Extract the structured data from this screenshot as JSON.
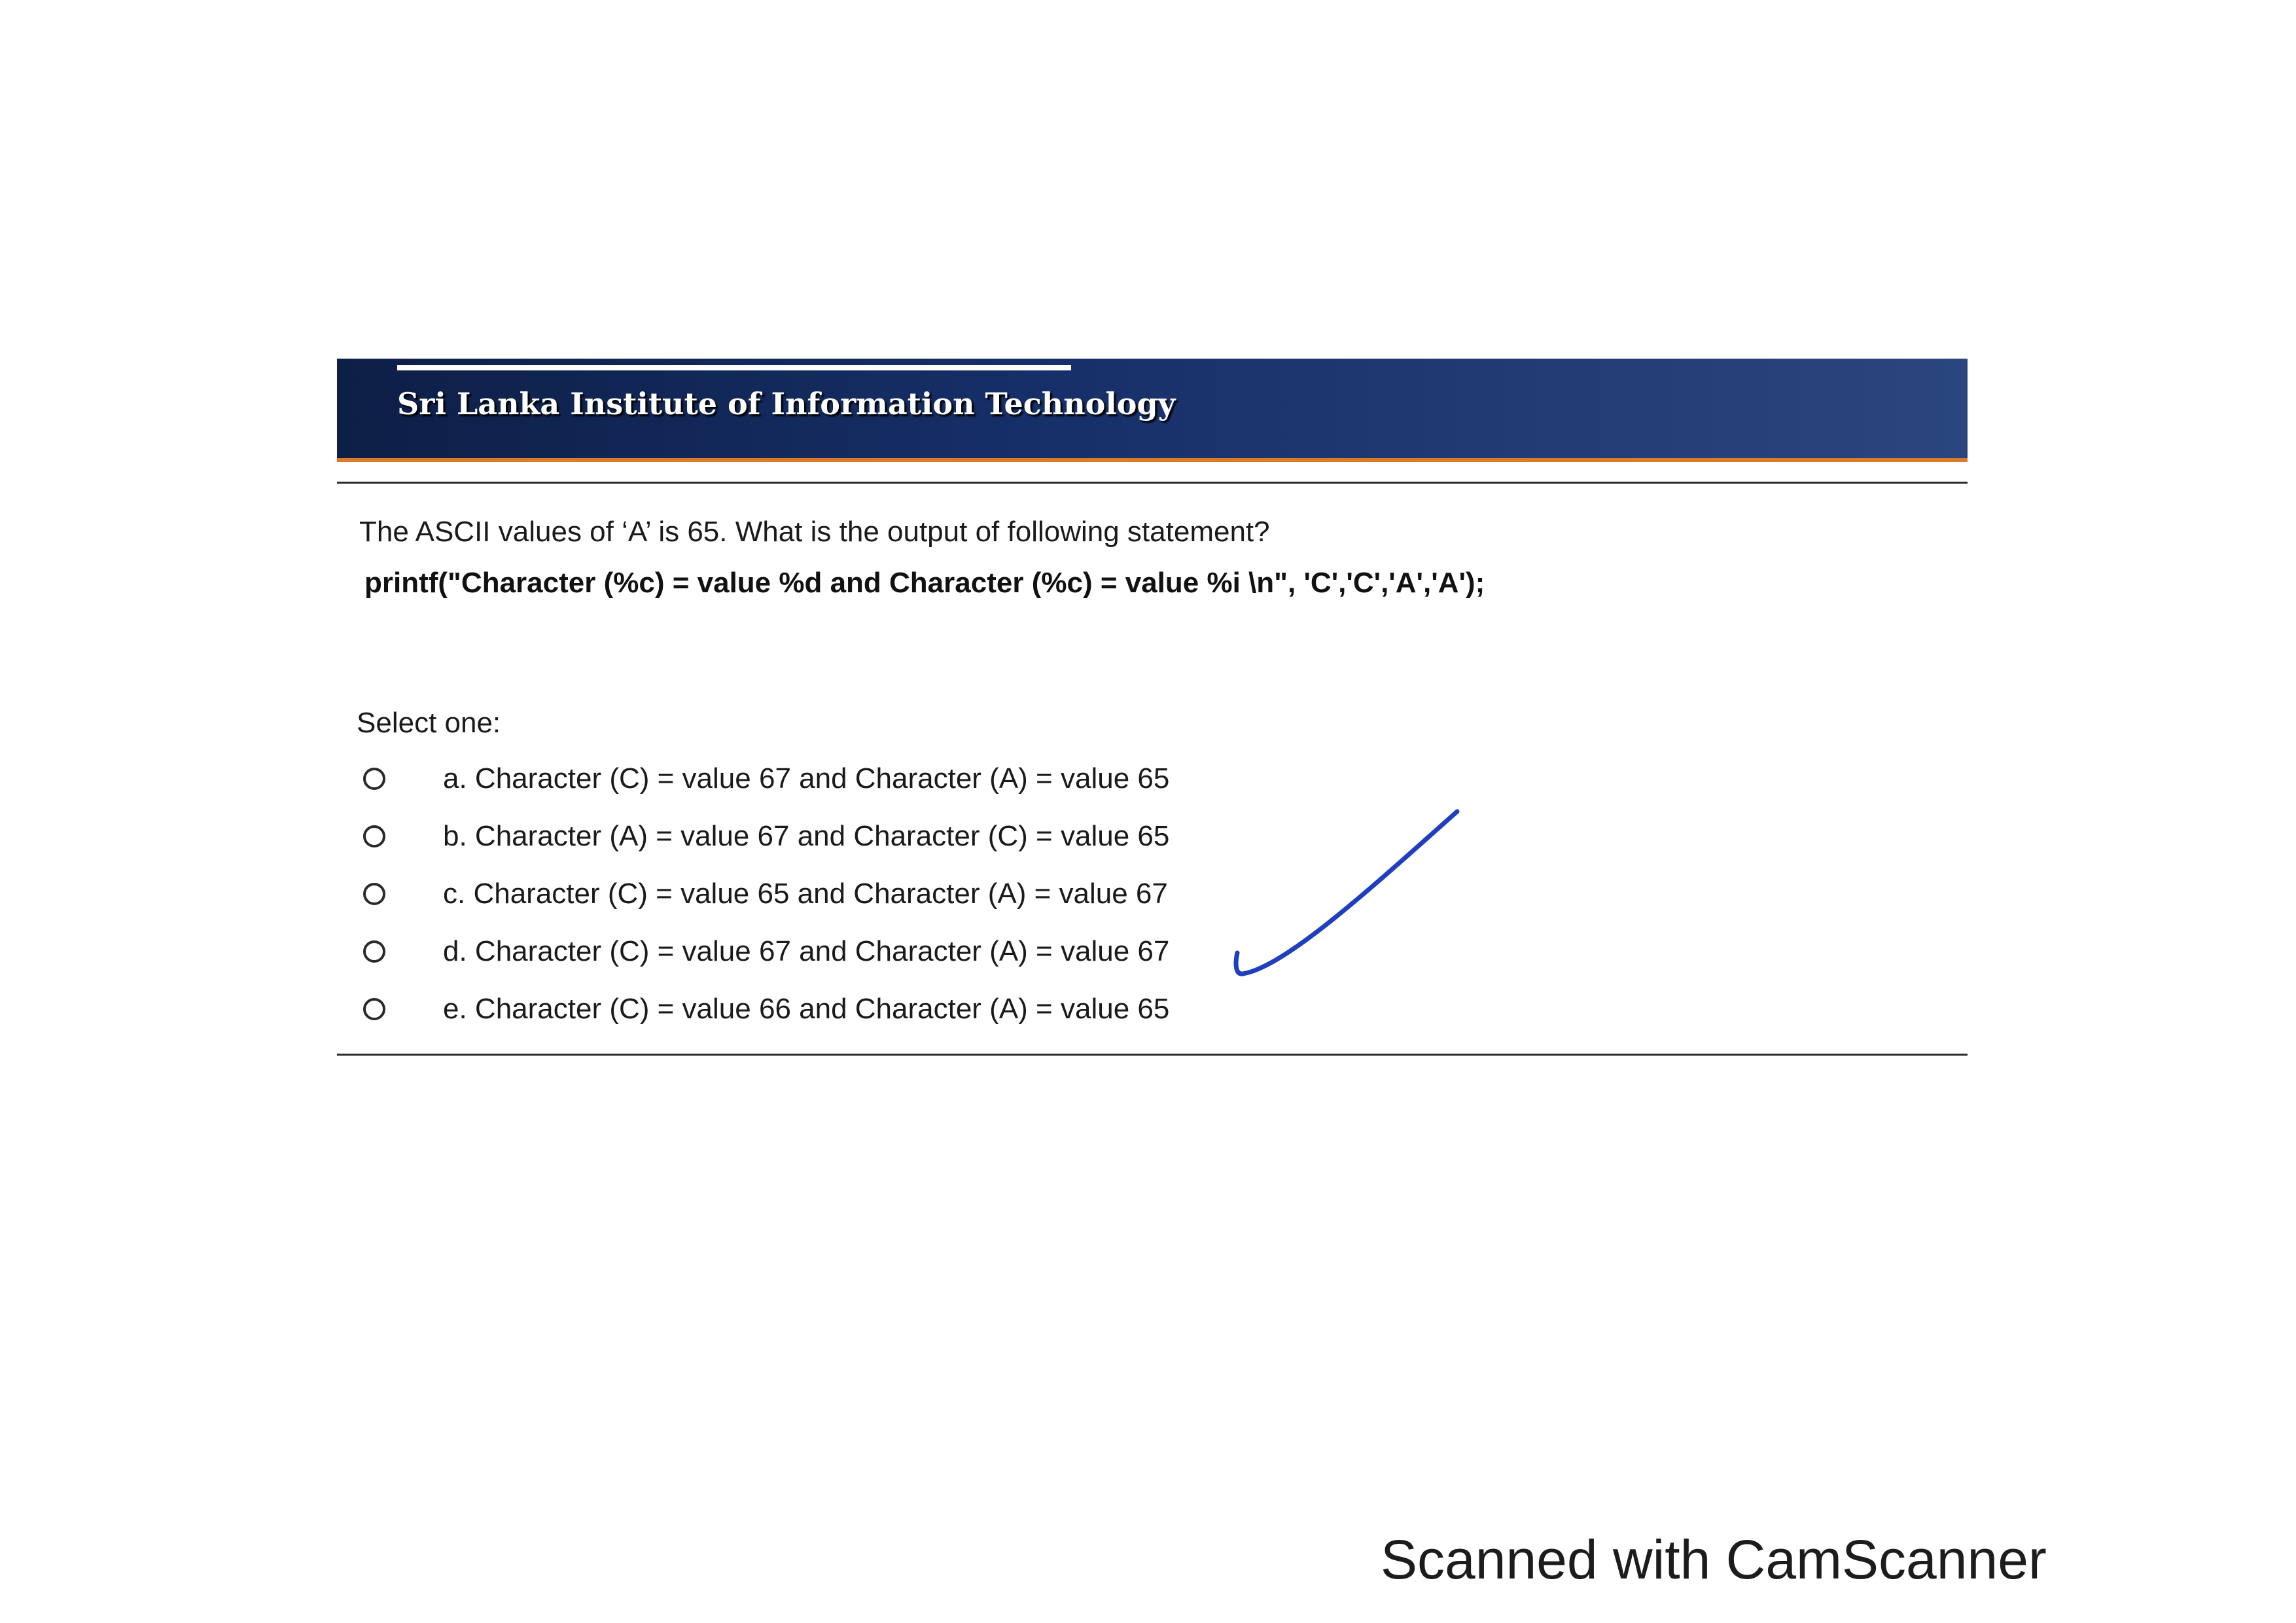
{
  "banner": {
    "title": "Sri Lanka Institute of Information Technology",
    "color": "#17306a",
    "accent": "#d97b2a"
  },
  "question": {
    "text": "The ASCII values of ‘A’ is 65.  What is the output of following statement?",
    "code": "printf(\"Character (%c) = value %d and Character (%c) = value %i \\n\", 'C','C','A','A');"
  },
  "select_label": "Select one:",
  "options": [
    {
      "label": "a. Character (C) = value 67 and Character (A) = value 65",
      "selected": false
    },
    {
      "label": "b. Character (A) = value 67 and Character (C) = value 65",
      "selected": false
    },
    {
      "label": "c. Character (C) = value 65 and Character (A) = value 67",
      "selected": false
    },
    {
      "label": "d. Character (C) = value 67 and Character (A) = value 67",
      "selected": false
    },
    {
      "label": "e. Character (C) = value 66 and Character (A) = value 65",
      "selected": false
    }
  ],
  "annotation": {
    "icon": "handwritten-checkmark-icon",
    "color": "#1f3fbf"
  },
  "footer": {
    "text": "Scanned with CamScanner"
  }
}
